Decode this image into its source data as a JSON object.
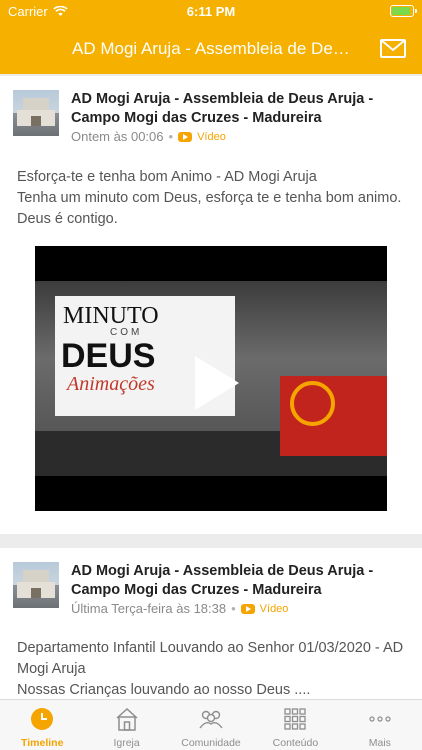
{
  "status": {
    "carrier": "Carrier",
    "time": "6:11 PM"
  },
  "navbar": {
    "title": "AD Mogi Aruja - Assembleia de Deus Aruja - Campo Mogi das Cruzes - Madureira",
    "mail_icon": "mail-icon"
  },
  "posts": [
    {
      "author": "AD Mogi Aruja - Assembleia de Deus Aruja - Campo Mogi das Cruzes - Madureira",
      "time": "Ontem às 00:06",
      "type": "Vídeo",
      "text": "Esforça-te e tenha bom Animo - AD Mogi Aruja\nTenha um minuto com Deus, esforça te e tenha bom animo. Deus é contigo.",
      "video": {
        "line1": "MINUTO",
        "line2": "COM",
        "line3": "DEUS",
        "line4": "Animações"
      }
    },
    {
      "author": "AD Mogi Aruja - Assembleia de Deus Aruja - Campo Mogi das Cruzes - Madureira",
      "time": "Última Terça-feira às 18:38",
      "type": "Vídeo",
      "text": "Departamento Infantil Louvando ao Senhor 01/03/2020 - AD Mogi Aruja\nNossas Crianças louvando ao nosso Deus ...."
    }
  ],
  "tabs": [
    {
      "label": "Timeline",
      "icon": "clock-icon",
      "active": true
    },
    {
      "label": "Igreja",
      "icon": "church-icon",
      "active": false
    },
    {
      "label": "Comunidade",
      "icon": "people-icon",
      "active": false
    },
    {
      "label": "Conteúdo",
      "icon": "grid-icon",
      "active": false
    },
    {
      "label": "Mais",
      "icon": "more-icon",
      "active": false
    }
  ],
  "colors": {
    "accent": "#f5b000",
    "accent_text": "#f5a400",
    "muted": "#8e8e8e"
  }
}
